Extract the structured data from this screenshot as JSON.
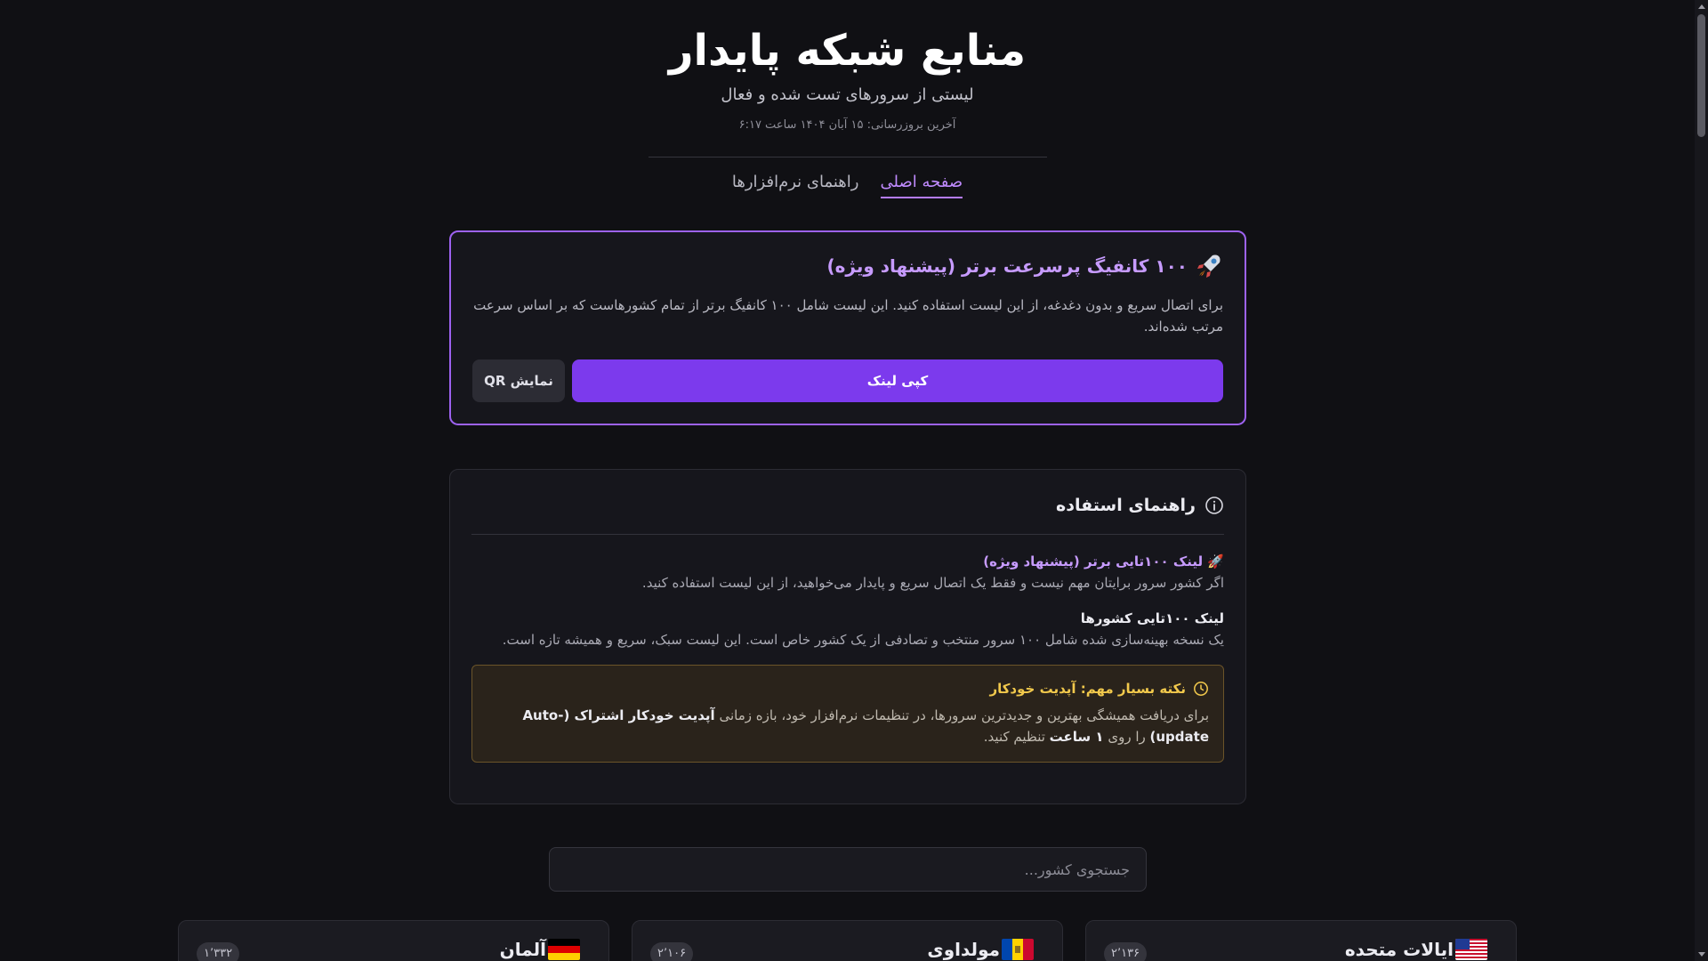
{
  "header": {
    "title": "منابع شبکه پایدار",
    "subtitle": "لیستی از سرورهای تست شده و فعال",
    "last_update": "آخرین بروزرسانی: ۱۵ آبان ۱۴۰۴ ساعت ۶:۱۷"
  },
  "nav": {
    "tabs": [
      {
        "label": "صفحه اصلی",
        "active": true
      },
      {
        "label": "راهنمای نرم‌افزارها",
        "active": false
      }
    ]
  },
  "featured": {
    "icon": "rocket-icon",
    "title": "۱۰۰ کانفیگ پرسرعت برتر (پیشنهاد ویژه)",
    "description": "برای اتصال سریع و بدون دغدغه، از این لیست استفاده کنید. این لیست شامل ۱۰۰ کانفیگ برتر از تمام کشورهاست که بر اساس سرعت مرتب شده‌اند.",
    "copy_label": "کپی لینک",
    "qr_label": "نمایش QR",
    "accent_color": "#7c3aed"
  },
  "guide": {
    "title": "راهنمای استفاده",
    "icon": "info-icon",
    "items": [
      {
        "title": "🚀 لینک ۱۰۰تایی برتر (پیشنهاد ویژه)",
        "text": "اگر کشور سرور برایتان مهم نیست و فقط یک اتصال سریع و پایدار می‌خواهید، از این لیست استفاده کنید."
      },
      {
        "title": "لینک ۱۰۰تایی کشورها",
        "text": "یک نسخه بهینه‌سازی شده شامل ۱۰۰ سرور منتخب و تصادفی از یک کشور خاص است. این لیست سبک، سریع و همیشه تازه است."
      }
    ],
    "notice": {
      "icon": "clock-icon",
      "title": "نکته بسیار مهم: آپدیت خودکار",
      "text_1": "برای دریافت همیشگی بهترین و جدیدترین سرورها، در تنظیمات نرم‌افزار خود، بازه زمانی ",
      "bold_1": "آپدیت خودکار اشتراک (Auto-update)",
      "text_2": " را روی ",
      "bold_2": "۱ ساعت",
      "text_3": " تنظیم کنید.",
      "color": "#f2c94c"
    }
  },
  "search": {
    "placeholder": "جستجوی کشور..."
  },
  "countries": [
    {
      "name": "ایالات متحده",
      "flag": "us-flag",
      "count": "۲٬۱۳۶"
    },
    {
      "name": "مولداوی",
      "flag": "md-flag",
      "count": "۲٬۱۰۶"
    },
    {
      "name": "آلمان",
      "flag": "de-flag",
      "count": "۱٬۳۳۲"
    }
  ]
}
